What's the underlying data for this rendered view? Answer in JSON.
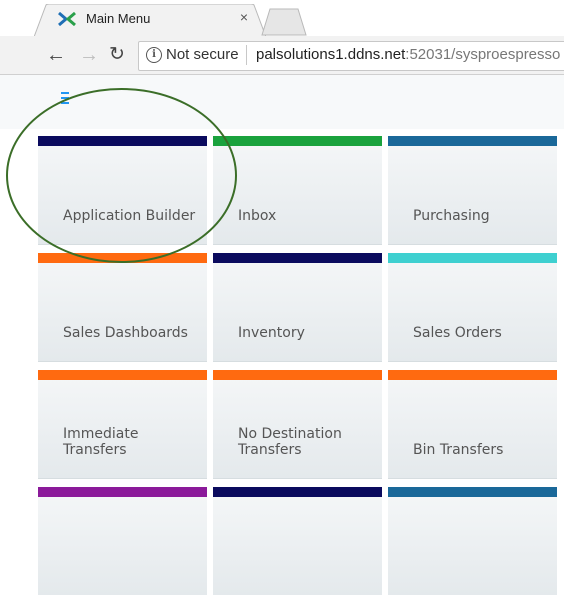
{
  "browser": {
    "tab_title": "Main Menu",
    "tab_close": "×",
    "address": {
      "security_label": "Not secure",
      "url_host": "palsolutions1.ddns.net",
      "url_rest": ":52031/sysproespresso"
    }
  },
  "app": {
    "menu_icon": "hamburger-icon"
  },
  "tiles": [
    {
      "label": "Application Builder",
      "bar_color": "#0b0b5e"
    },
    {
      "label": "Inbox",
      "bar_color": "#1aa23d"
    },
    {
      "label": "Purchasing",
      "bar_color": "#1a6899"
    },
    {
      "label": "Sales Dashboards",
      "bar_color": "#ff6a10"
    },
    {
      "label": "Inventory",
      "bar_color": "#0b0b5e"
    },
    {
      "label": "Sales Orders",
      "bar_color": "#3ed0d0"
    },
    {
      "label": "Immediate Transfers",
      "bar_color": "#ff6a10"
    },
    {
      "label": "No Destination Transfers",
      "bar_color": "#ff6a10"
    },
    {
      "label": "Bin Transfers",
      "bar_color": "#ff6a10"
    },
    {
      "label": "",
      "bar_color": "#8b1a9a"
    },
    {
      "label": "",
      "bar_color": "#0b0b5e"
    },
    {
      "label": "",
      "bar_color": "#1a6899"
    }
  ],
  "annotation": {
    "ring_color": "#3b6e28"
  }
}
